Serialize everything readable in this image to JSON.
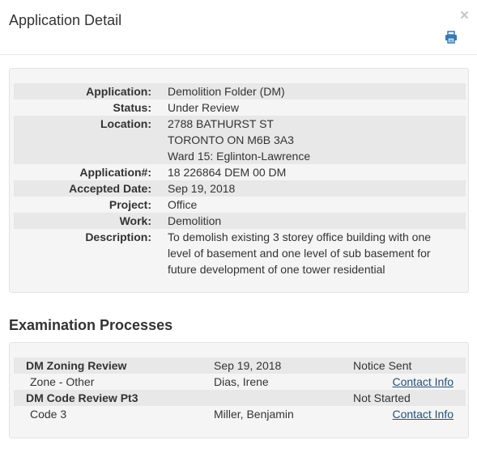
{
  "header": {
    "title": "Application Detail",
    "close_glyph": "×",
    "print_icon": "printer-icon"
  },
  "detail": {
    "rows": [
      {
        "label": "Application:",
        "lines": [
          "Demolition Folder (DM)"
        ]
      },
      {
        "label": "Status:",
        "lines": [
          "Under Review"
        ]
      },
      {
        "label": "Location:",
        "lines": [
          "2788 BATHURST ST",
          "TORONTO ON M6B 3A3",
          "Ward 15: Eglinton-Lawrence"
        ]
      },
      {
        "label": "Application#:",
        "lines": [
          "18 226864 DEM 00 DM"
        ]
      },
      {
        "label": "Accepted Date:",
        "lines": [
          "Sep 19, 2018"
        ]
      },
      {
        "label": "Project:",
        "lines": [
          "Office"
        ]
      },
      {
        "label": "Work:",
        "lines": [
          "Demolition"
        ]
      },
      {
        "label": "Description:",
        "lines": [
          "To demolish existing 3 storey office building with one",
          "level of basement and one level of sub basement for",
          "future development of one tower residential"
        ]
      }
    ]
  },
  "exam": {
    "title": "Examination Processes",
    "rows": [
      {
        "name": "DM Zoning Review",
        "date": "Sep 19, 2018",
        "status": "Notice Sent"
      },
      {
        "name": "Zone - Other",
        "date": "Dias, Irene",
        "status": "Contact Info"
      },
      {
        "name": "DM Code Review Pt3",
        "date": "",
        "status": "Not Started"
      },
      {
        "name": "Code 3",
        "date": "Miller, Benjamin",
        "status": "Contact Info"
      }
    ]
  },
  "colors": {
    "link": "#23527c",
    "panel_bg": "#f5f5f5",
    "row_shade": "#e8e8e8"
  }
}
